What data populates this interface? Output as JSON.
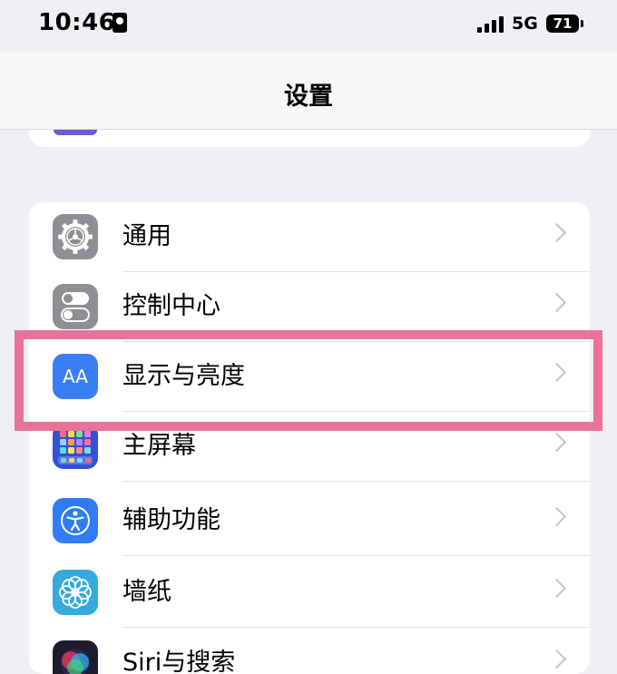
{
  "status_bar": {
    "time": "10:46",
    "network": "5G",
    "battery": "71"
  },
  "nav": {
    "title": "设置"
  },
  "settings": [
    {
      "label": "通用",
      "icon": "gear-icon",
      "color": "#8e8e93"
    },
    {
      "label": "控制中心",
      "icon": "toggles-icon",
      "color": "#8e8e93"
    },
    {
      "label": "显示与亮度",
      "icon": "aa-text-icon",
      "icon_text": "AA",
      "color": "#3a7ef5"
    },
    {
      "label": "主屏幕",
      "icon": "home-grid-icon",
      "color": "#3352d6"
    },
    {
      "label": "辅助功能",
      "icon": "accessibility-icon",
      "color": "#2f7cf6"
    },
    {
      "label": "墙纸",
      "icon": "flower-icon",
      "color": "#35aadc"
    },
    {
      "label": "Siri与搜索",
      "icon": "siri-icon",
      "color": "#1c1c2e"
    }
  ],
  "highlight_color": "#e8729a"
}
